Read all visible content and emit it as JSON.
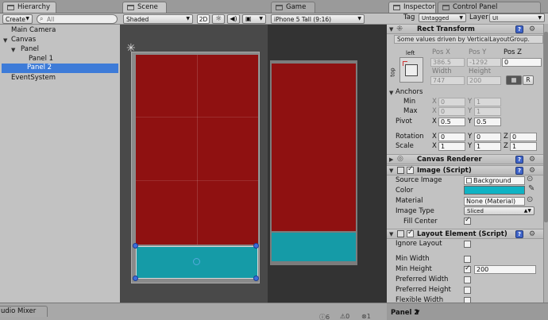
{
  "hierarchy": {
    "tab": "Hierarchy",
    "create_label": "Create",
    "search_placeholder": "All",
    "items": [
      "Main Camera",
      "Canvas",
      "Panel",
      "Panel 1",
      "Panel 2",
      "EventSystem"
    ]
  },
  "scene": {
    "tab": "Scene",
    "shading": "Shaded",
    "mode_2d": "2D",
    "sun_icon": "sun-icon",
    "audio_icon": "speaker-icon",
    "image_icon": "image-icon"
  },
  "game": {
    "tab": "Game",
    "aspect": "iPhone 5 Tall (9:16)"
  },
  "inspector": {
    "tab": "Inspector",
    "tab2": "Control Panel",
    "tag_label": "Tag",
    "tag_value": "Untagged",
    "layer_label": "Layer",
    "layer_value": "UI",
    "driven_note": "Some values driven by VerticalLayoutGroup.",
    "rect_transform": {
      "title": "Rect Transform",
      "anchor_left": "left",
      "anchor_top": "top",
      "pos_x_label": "Pos X",
      "pos_x": "386.5",
      "pos_y_label": "Pos Y",
      "pos_y": "-1292",
      "pos_z_label": "Pos Z",
      "pos_z": "0",
      "width_label": "Width",
      "width": "747",
      "height_label": "Height",
      "height": "200",
      "r_button": "R",
      "anchors_label": "Anchors",
      "min_label": "Min",
      "min_x": "0",
      "min_y": "1",
      "max_label": "Max",
      "max_x": "0",
      "max_y": "1",
      "pivot_label": "Pivot",
      "pivot_x": "0.5",
      "pivot_y": "0.5",
      "rotation_label": "Rotation",
      "rot_x": "0",
      "rot_y": "0",
      "rot_z": "0",
      "scale_label": "Scale",
      "scale_x": "1",
      "scale_y": "1",
      "scale_z": "1",
      "x": "X",
      "y": "Y",
      "z": "Z"
    },
    "canvas_renderer": {
      "title": "Canvas Renderer"
    },
    "image": {
      "title": "Image (Script)",
      "source_label": "Source Image",
      "source_value": "Background",
      "color_label": "Color",
      "color_value": "#0fb3c4",
      "material_label": "Material",
      "material_value": "None (Material)",
      "type_label": "Image Type",
      "type_value": "Sliced",
      "fill_label": "Fill Center"
    },
    "layout_element": {
      "title": "Layout Element (Script)",
      "ignore_label": "Ignore Layout",
      "min_width_label": "Min Width",
      "min_height_label": "Min Height",
      "min_height_value": "200",
      "pref_width_label": "Preferred Width",
      "pref_height_label": "Preferred Height",
      "flex_width_label": "Flexible Width"
    },
    "preview_label": "Panel 2"
  },
  "bottom": {
    "audio_mixer": "udio Mixer",
    "count1": "6",
    "count2": "0",
    "count3": "1"
  },
  "colors": {
    "panel_red": "#8f1111",
    "panel_teal": "#159ba7",
    "selection_blue": "#3d7bd8"
  }
}
